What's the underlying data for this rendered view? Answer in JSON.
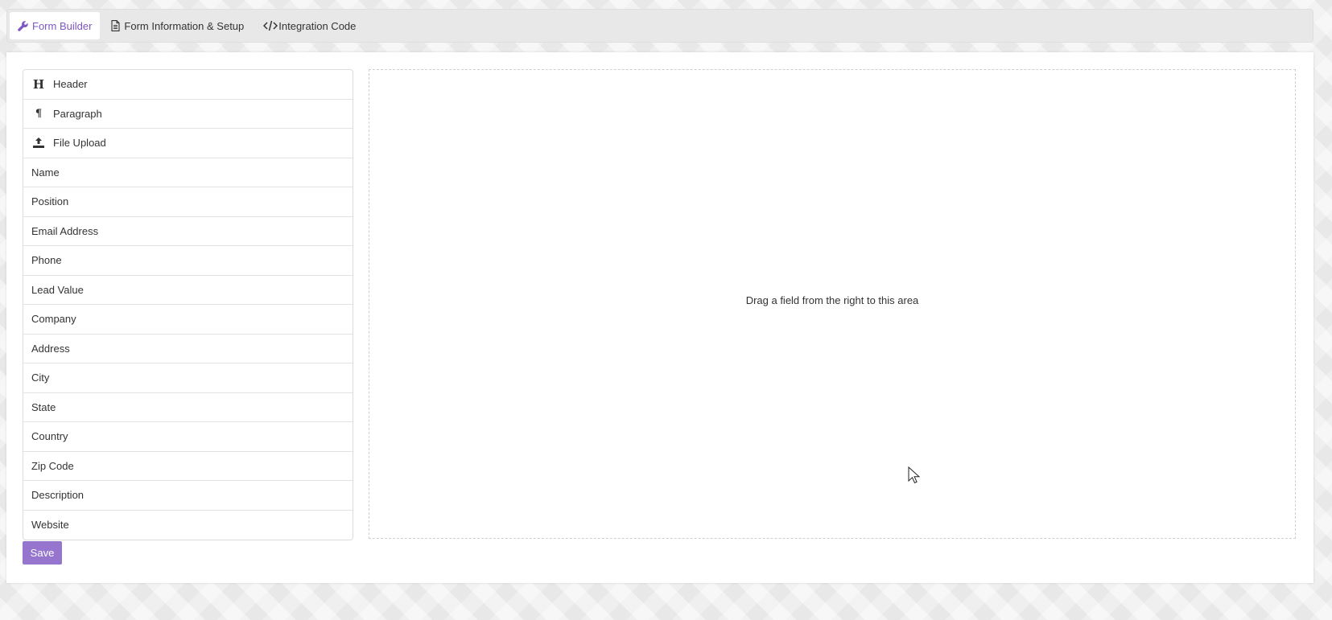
{
  "tabs": [
    {
      "label": "Form Builder",
      "icon": "wrench-icon",
      "active": true
    },
    {
      "label": "Form Information & Setup",
      "icon": "document-icon",
      "active": false
    },
    {
      "label": "Integration Code",
      "icon": "code-icon",
      "active": false
    }
  ],
  "fields": {
    "header": "Header",
    "paragraph": "Paragraph",
    "file_upload": "File Upload",
    "name": "Name",
    "position": "Position",
    "email": "Email Address",
    "phone": "Phone",
    "lead_value": "Lead Value",
    "company": "Company",
    "address": "Address",
    "city": "City",
    "state": "State",
    "country": "Country",
    "zip": "Zip Code",
    "description": "Description",
    "website": "Website"
  },
  "drop_area": {
    "text": "Drag a field from the right to this area"
  },
  "save_label": "Save",
  "colors": {
    "accent": "#7e57c2",
    "button": "#9575cd"
  }
}
